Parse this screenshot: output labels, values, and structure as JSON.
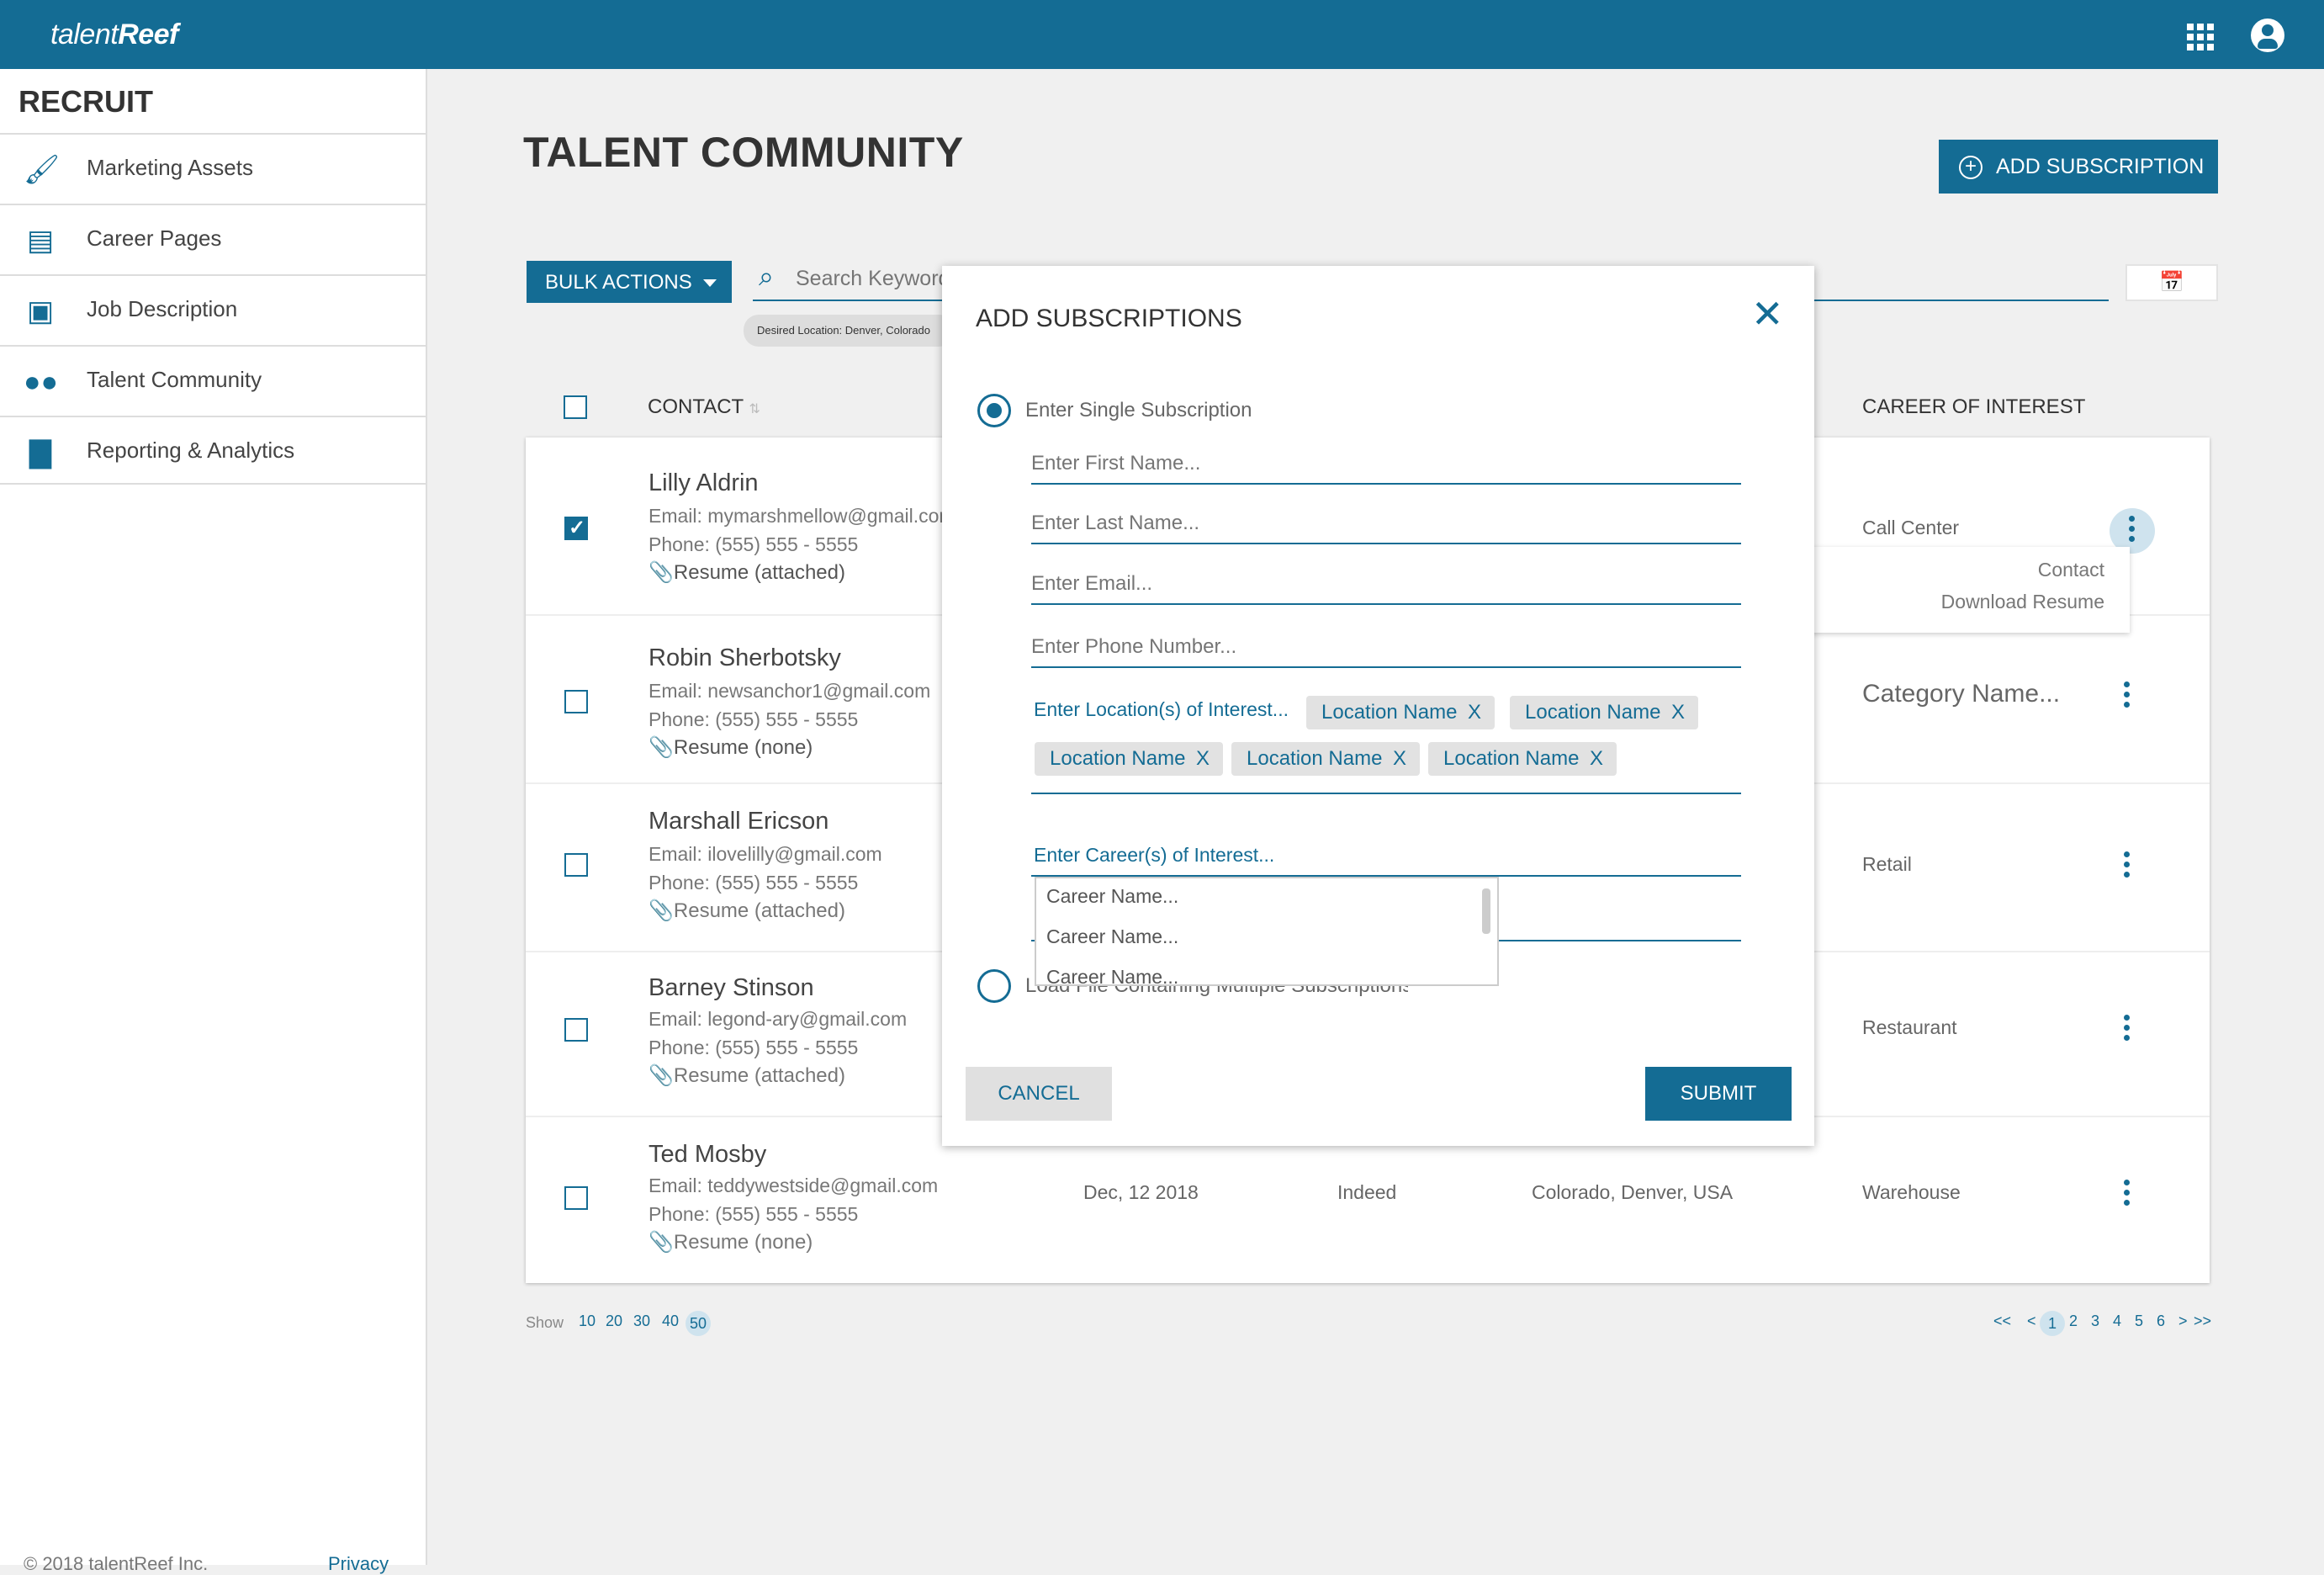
{
  "app": {
    "brand_left": "talent",
    "brand_right": "Reef"
  },
  "sidebar": {
    "title": "RECRUIT",
    "items": [
      {
        "label": "Marketing Assets",
        "icon": "paint-roller-icon"
      },
      {
        "label": "Career Pages",
        "icon": "web-page-icon"
      },
      {
        "label": "Job Description",
        "icon": "id-badge-icon"
      },
      {
        "label": "Talent Community",
        "icon": "people-icon"
      },
      {
        "label": "Reporting & Analytics",
        "icon": "bar-chart-icon"
      }
    ],
    "footer": "© 2018 talentReef Inc.",
    "privacy": "Privacy"
  },
  "main": {
    "title": "TALENT COMMUNITY",
    "add_subscription": "ADD SUBSCRIPTION",
    "bulk_actions": "BULK ACTIONS",
    "search_placeholder": "Search Keyword",
    "filter_chip": "Desired Location: Denver, Colorado",
    "headers": {
      "contact": "CONTACT",
      "career": "CAREER OF INTEREST"
    }
  },
  "rows": [
    {
      "name": "Lilly Aldrin",
      "email": "Email: mymarshmellow@gmail.com",
      "phone": "Phone: (555) 555 - 5555",
      "resume": "Resume (attached)",
      "checked": true,
      "date": "",
      "source": "",
      "location": "",
      "career": "Call Center"
    },
    {
      "name": "Robin Sherbotsky",
      "email": "Email: newsanchor1@gmail.com",
      "phone": "Phone: (555) 555 - 5555",
      "resume": "Resume (none)",
      "checked": false,
      "date": "",
      "source": "",
      "location": "",
      "career": "Category Name..."
    },
    {
      "name": "Marshall Ericson",
      "email": "Email: ilovelilly@gmail.com",
      "phone": "Phone: (555) 555 - 5555",
      "resume": "Resume (attached)",
      "checked": false,
      "date": "",
      "source": "",
      "location": "",
      "career": "Retail"
    },
    {
      "name": "Barney Stinson",
      "email": "Email: legond-ary@gmail.com",
      "phone": "Phone: (555) 555 - 5555",
      "resume": "Resume (attached)",
      "checked": false,
      "date": "",
      "source": "",
      "location": "",
      "career": "Restaurant"
    },
    {
      "name": "Ted Mosby",
      "email": "Email: teddywestside@gmail.com",
      "phone": "Phone: (555) 555 - 5555",
      "resume": "Resume (none)",
      "checked": false,
      "date": "Dec, 12 2018",
      "source": "Indeed",
      "location": "Colorado, Denver, USA",
      "career": "Warehouse"
    }
  ],
  "context_menu": {
    "contact": "Contact",
    "download": "Download Resume"
  },
  "pagination": {
    "show_label": "Show",
    "sizes": [
      "10",
      "20",
      "30",
      "40",
      "50"
    ],
    "active_size": "50",
    "first": "<<",
    "prev": "<",
    "pages": [
      "1",
      "2",
      "3",
      "4",
      "5",
      "6"
    ],
    "next": ">",
    "last": ">>"
  },
  "modal": {
    "title": "ADD SUBSCRIPTIONS",
    "option_single": "Enter Single Subscription",
    "first_name": "Enter First Name...",
    "last_name": "Enter Last Name...",
    "email": "Enter Email...",
    "phone": "Enter Phone Number...",
    "locations_label": "Enter Location(s) of Interest...",
    "location_tags": [
      "Location Name",
      "Location Name",
      "Location Name",
      "Location Name",
      "Location Name"
    ],
    "tag_remove": "X",
    "careers_label": "Enter Career(s) of Interest...",
    "career_options": [
      "Career Name...",
      "Career Name...",
      "Career Name..."
    ],
    "option_file": "Load File Containing Multiple Subscriptions",
    "cancel": "CANCEL",
    "submit": "SUBMIT"
  },
  "colors": {
    "brand": "#146c94",
    "background": "#f0f0f0",
    "checkbox_check": "#146c94",
    "clip_attached": "#3aaa35",
    "clip_none": "#cccccc"
  }
}
